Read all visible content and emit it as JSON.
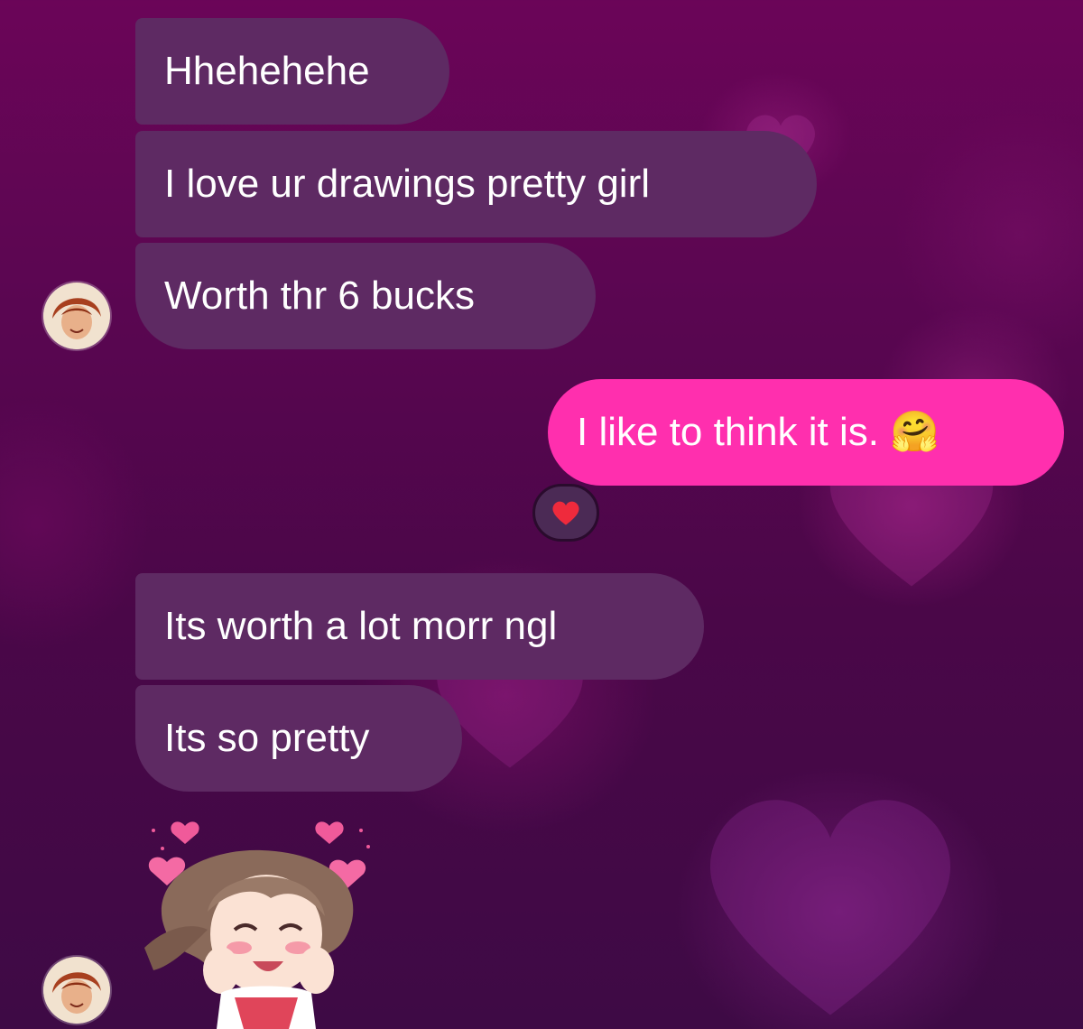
{
  "messages": {
    "m1": "Hhehehehe",
    "m2": "I love ur drawings pretty girl",
    "m3": "Worth thr 6 bucks",
    "m4": "I like to think it is. 🤗",
    "m5": "Its worth a lot morr ngl",
    "m6": "Its so pretty"
  },
  "reaction": {
    "emoji_name": "red-heart"
  },
  "colors": {
    "incoming_bubble": "#5e2a63",
    "outgoing_bubble": "#ff2fae",
    "background": "#5a0651"
  }
}
